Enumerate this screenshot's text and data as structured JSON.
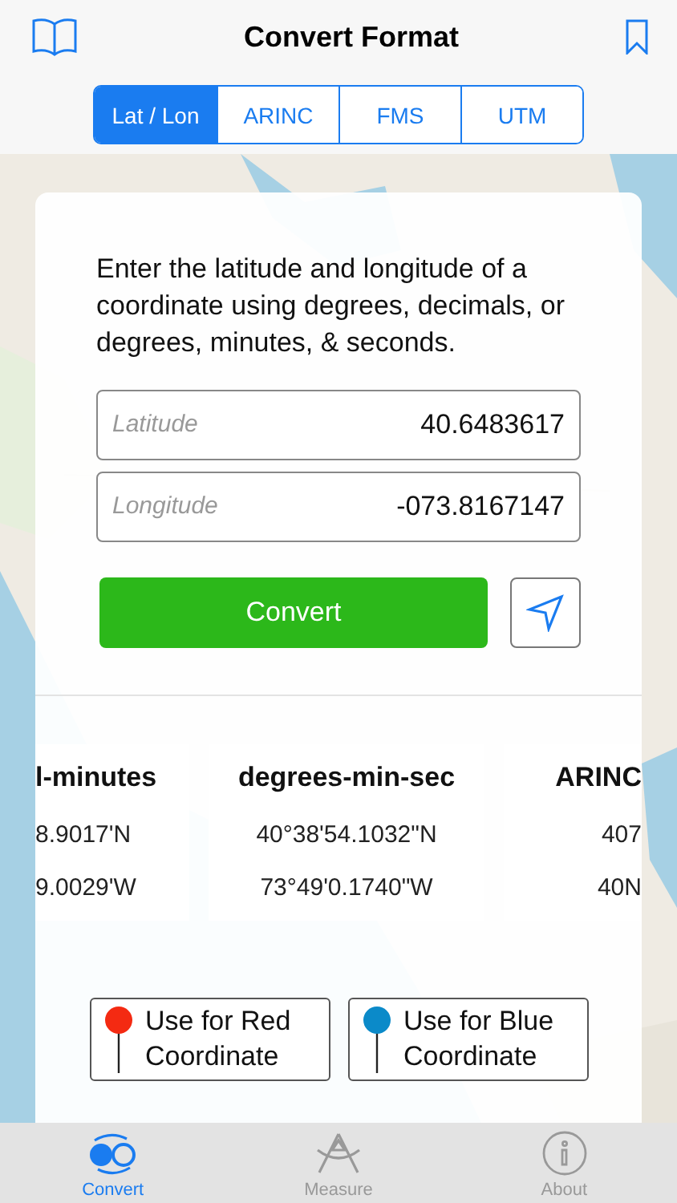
{
  "header": {
    "title": "Convert Format"
  },
  "segments": [
    {
      "label": "Lat / Lon",
      "selected": true
    },
    {
      "label": "ARINC",
      "selected": false
    },
    {
      "label": "FMS",
      "selected": false
    },
    {
      "label": "UTM",
      "selected": false
    }
  ],
  "panel": {
    "instructions": "Enter the latitude and longitude of a coordinate using degrees, decimals, or degrees, minutes, & seconds.",
    "latitude": {
      "placeholder": "Latitude",
      "value": "40.6483617"
    },
    "longitude": {
      "placeholder": "Longitude",
      "value": "-073.8167147"
    },
    "convert_button": "Convert",
    "results": [
      {
        "heading": "l-minutes",
        "lines": [
          "8.9017'N",
          "9.0029'W"
        ]
      },
      {
        "heading": "degrees-min-sec",
        "lines": [
          "40°38'54.1032\"N",
          "73°49'0.1740\"W"
        ]
      },
      {
        "heading": "ARINC",
        "lines": [
          "407",
          "40N"
        ]
      }
    ],
    "pin_buttons": [
      {
        "label": "Use for Red Coordinate",
        "color": "#f42a12"
      },
      {
        "label": "Use for Blue Coordinate",
        "color": "#0b8ac9"
      }
    ]
  },
  "tab_bar": [
    {
      "label": "Convert",
      "selected": true
    },
    {
      "label": "Measure",
      "selected": false
    },
    {
      "label": "About",
      "selected": false
    }
  ]
}
